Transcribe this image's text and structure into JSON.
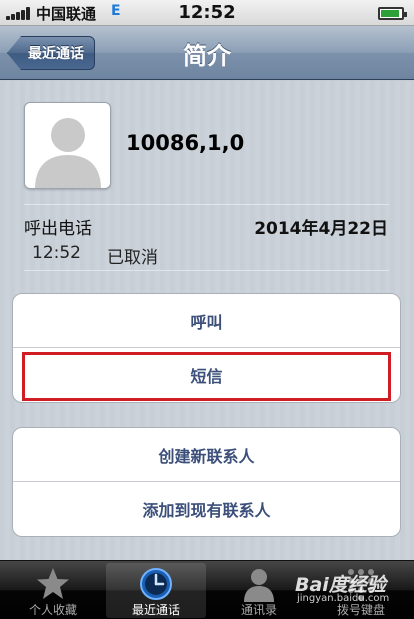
{
  "status_bar": {
    "carrier": "中国联通",
    "network": "E",
    "time": "12:52"
  },
  "nav": {
    "back_label": "最近通话",
    "title": "简介"
  },
  "contact": {
    "name": "10086,1,0"
  },
  "call": {
    "type": "呼出电话",
    "date": "2014年4月22日",
    "time": "12:52",
    "status": "已取消"
  },
  "actions": {
    "call_label": "呼叫",
    "sms_label": "短信",
    "create_contact_label": "创建新联系人",
    "add_existing_label": "添加到现有联系人"
  },
  "tabs": [
    {
      "label": "个人收藏",
      "icon": "star-icon"
    },
    {
      "label": "最近通话",
      "icon": "clock-icon"
    },
    {
      "label": "通讯录",
      "icon": "person-icon"
    },
    {
      "label": "拨号键盘",
      "icon": "keypad-icon"
    }
  ],
  "watermark": {
    "main": "Bai度经验",
    "sub": "jingyan.baidu.com"
  },
  "colors": {
    "highlight": "#d01d24",
    "action_text": "#3b4f7a"
  }
}
